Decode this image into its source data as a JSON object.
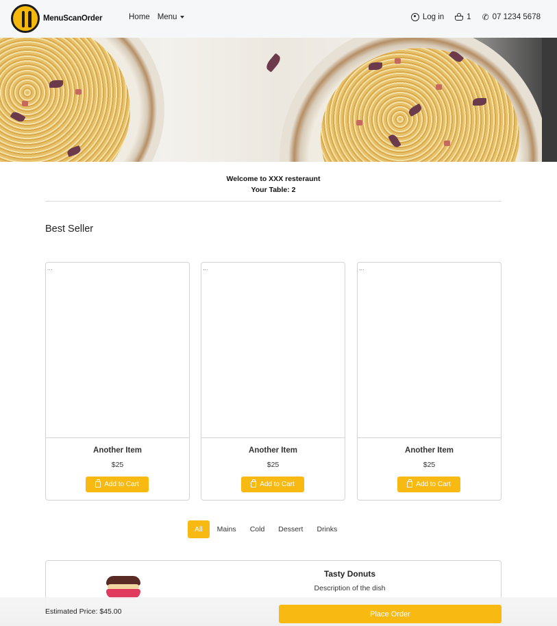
{
  "navbar": {
    "brand": "MenuScanOrder",
    "links": [
      "Home",
      "Menu"
    ],
    "login": "Log in",
    "cart_count": "1",
    "phone": "07 1234 5678",
    "icons": {
      "login": "user-circle-icon",
      "cart": "basket-icon",
      "phone": "phone-icon"
    }
  },
  "welcome": {
    "line1": "Welcome to XXX resteraunt",
    "line2": "Your Table: 2"
  },
  "best_seller": {
    "title": "Best Seller",
    "items": [
      {
        "image_alt": "...",
        "name": "Another Item",
        "price": "$25",
        "button": "Add to Cart"
      },
      {
        "image_alt": "...",
        "name": "Another Item",
        "price": "$25",
        "button": "Add to Cart"
      },
      {
        "image_alt": "...",
        "name": "Another Item",
        "price": "$25",
        "button": "Add to Cart"
      }
    ]
  },
  "filters": {
    "tabs": [
      "All",
      "Mains",
      "Cold",
      "Dessert",
      "Drinks"
    ],
    "active": "All"
  },
  "dish": {
    "name": "Tasty Donuts",
    "description": "Description of the dish"
  },
  "footer": {
    "estimated_price": "Estimated Price: $45.00",
    "place_order": "Place Order"
  },
  "colors": {
    "accent": "#f7b912",
    "navbar_bg": "#f6f7f9"
  }
}
